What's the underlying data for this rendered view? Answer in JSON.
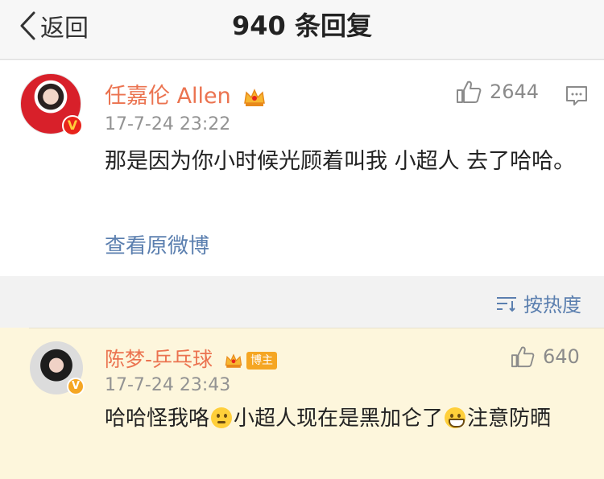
{
  "header": {
    "back_label": "返回",
    "title": "940 条回复"
  },
  "post": {
    "username": "任嘉伦 Allen",
    "timestamp": "17-7-24 23:22",
    "like_count": "2644",
    "content": "那是因为你小时候光顾着叫我 小超人 去了哈哈。",
    "view_original": "查看原微博"
  },
  "sortbar": {
    "label": "按热度"
  },
  "reply": {
    "username": "陈梦-乒乓球",
    "badge": "博主",
    "timestamp": "17-7-24 23:43",
    "like_count": "640",
    "text_part1": "哈哈怪我咯",
    "text_part2": "小超人现在是黑加仑了",
    "text_part3": "注意防晒"
  },
  "icons": {
    "back": "chevron-left-icon",
    "like": "thumbs-up-icon",
    "comment": "comment-icon",
    "crown": "crown-icon",
    "sort": "sort-icon",
    "verified": "verified-badge-icon"
  },
  "colors": {
    "username": "#eb7350",
    "link": "#5b7faf",
    "reply_bg": "#fdf6dc",
    "timestamp": "#939393"
  }
}
